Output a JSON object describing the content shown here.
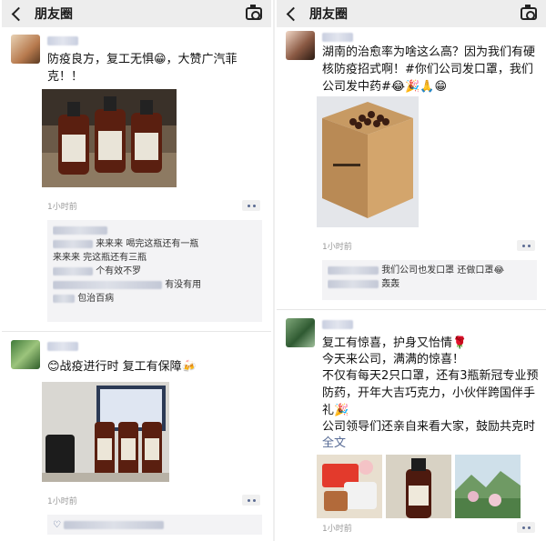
{
  "header": {
    "title": "朋友圈"
  },
  "left": {
    "post1": {
      "text": "防疫良方，复工无惧😁，大赞广汽菲克！！",
      "time": "1小时前",
      "comments": [
        {
          "text": "来来来  喝完这瓶还有一瓶"
        },
        {
          "text": "来来来  完这瓶还有三瓶"
        },
        {
          "text": "个有效不罗"
        },
        {
          "text": "有没有用"
        },
        {
          "text": "包治百病"
        }
      ]
    },
    "post2": {
      "text": "😊战疫进行时 复工有保障🍻",
      "time": "1小时前"
    }
  },
  "right": {
    "post1": {
      "text": "湖南的治愈率为啥这么高？因为我们有硬核防疫招式啊！#你们公司发口罩，我们公司发中药#😂🎉🙏😁",
      "time": "1小时前",
      "comments": [
        {
          "text": "我们公司也发口罩 还做口罩😂"
        },
        {
          "text": "轰轰"
        }
      ]
    },
    "post2": {
      "lines": [
        "复工有惊喜，护身又怡情🌹",
        "今天来公司，满满的惊喜！",
        "不仅有每天2只口罩，还有3瓶新冠专业预防药，开年大吉巧克力，小伙伴跨国伴手礼🎉",
        "公司领导们还亲自来看大家，鼓励共克时"
      ],
      "full_text_link": "全文",
      "time": "1小时前"
    }
  },
  "colors": {
    "link": "#576b95",
    "topbar": "#ededed",
    "comment_bg": "#f3f3f5"
  }
}
